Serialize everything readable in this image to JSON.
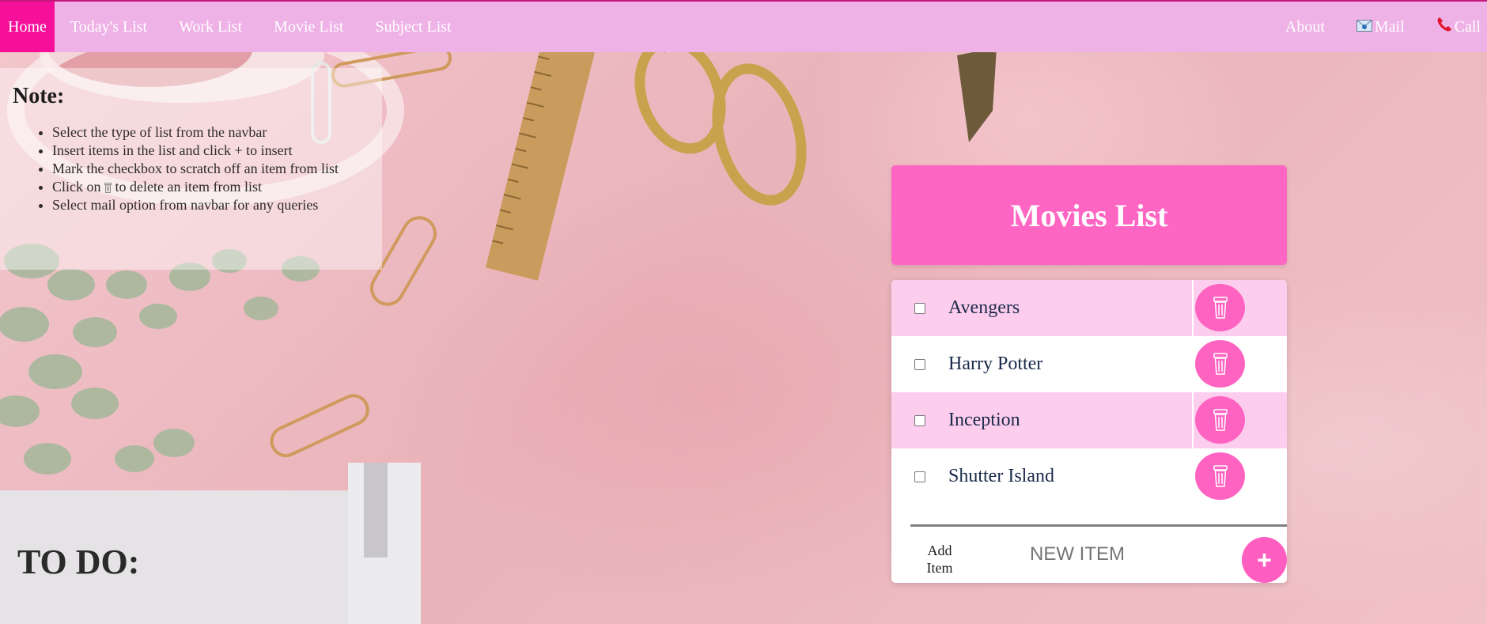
{
  "nav": {
    "items": [
      {
        "label": "Home",
        "active": true
      },
      {
        "label": "Today's List"
      },
      {
        "label": "Work List"
      },
      {
        "label": "Movie List"
      },
      {
        "label": "Subject List"
      }
    ],
    "right": {
      "about": "About",
      "mail": "Mail",
      "call": "Call",
      "mail_icon": "mail-icon",
      "call_icon": "phone-icon"
    }
  },
  "note": {
    "heading": "Note:",
    "bullets": [
      "Select the type of list from the navbar",
      "Insert items in the list and click + to insert",
      "Mark the checkbox to scratch off an item from list",
      {
        "before": "Click on",
        "after": "to delete an item from list"
      },
      "Select mail option from navbar for any queries"
    ]
  },
  "list": {
    "title": "Movies List",
    "items": [
      "Avengers",
      "Harry Potter",
      "Inception",
      "Shutter Island"
    ],
    "add_label": "Add Item",
    "input_placeholder": "NEW ITEM",
    "add_button": "+"
  },
  "background": {
    "note_text": "TO DO:"
  },
  "colors": {
    "navbar": "#efb2e7",
    "active_nav": "#f50f99",
    "accent": "#ff66c4",
    "row_pink": "#fdcdee"
  }
}
